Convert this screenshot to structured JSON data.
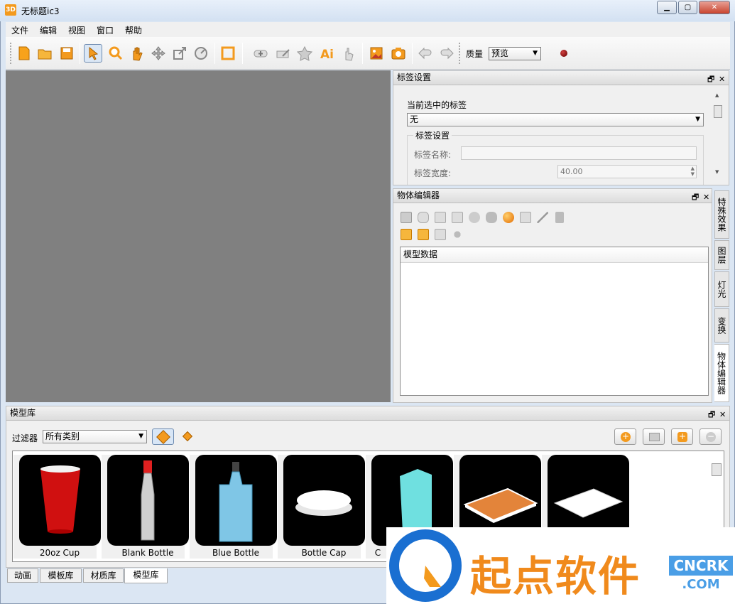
{
  "window": {
    "title": "无标题ic3",
    "app_icon_text": "3D"
  },
  "menu": [
    "文件",
    "编辑",
    "视图",
    "窗口",
    "帮助"
  ],
  "toolbar": {
    "quality_label": "质量",
    "quality_value": "预览"
  },
  "label_panel": {
    "title": "标签设置",
    "current_label_caption": "当前选中的标签",
    "current_label_value": "无",
    "group_title": "标签设置",
    "name_label": "标签名称:",
    "name_value": "",
    "width_label": "标签宽度:",
    "width_value": "40.00"
  },
  "object_panel": {
    "title": "物体编辑器",
    "tree_header": "模型数据"
  },
  "side_tabs": [
    "特殊效果",
    "图层",
    "灯光",
    "变换",
    "物体编辑器"
  ],
  "library": {
    "title": "模型库",
    "filter_label": "过滤器",
    "filter_value": "所有类别",
    "items": [
      "20oz Cup",
      "Blank Bottle",
      "Blue Bottle",
      "Bottle Cap",
      "C",
      "",
      ""
    ]
  },
  "bottom_tabs": [
    "动画",
    "模板库",
    "材质库",
    "模型库"
  ],
  "watermark": {
    "brand": "起点软件",
    "site_top": "CNCRK",
    "site_bottom": ".COM"
  },
  "colors": {
    "accent": "#f39a1e",
    "viewport": "#808080"
  }
}
